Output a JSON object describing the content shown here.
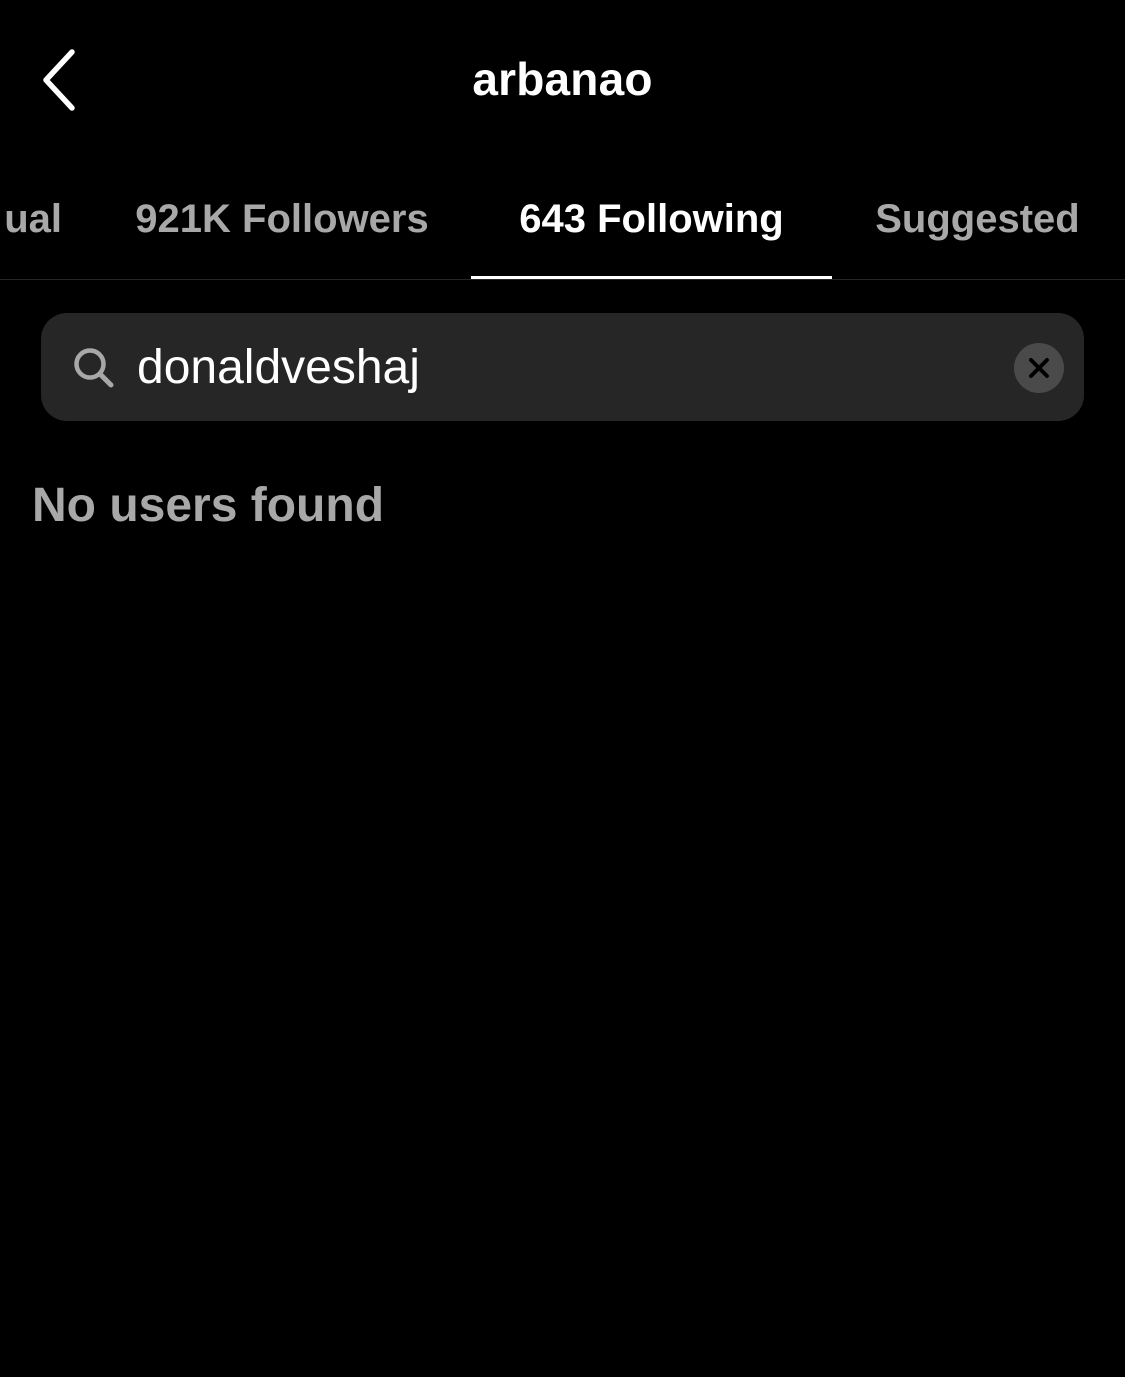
{
  "header": {
    "title": "arbanao",
    "back_icon": "chevron-left-icon"
  },
  "tabs": [
    {
      "label": "ual",
      "active": false
    },
    {
      "label": "921K Followers",
      "active": false
    },
    {
      "label": "643 Following",
      "active": true
    },
    {
      "label": "Suggested",
      "active": false
    }
  ],
  "search": {
    "value": "donaldveshaj",
    "icon": "search-icon",
    "clear_icon": "clear-icon"
  },
  "results": {
    "empty_message": "No users found"
  },
  "colors": {
    "background": "#000000",
    "primary_text": "#ffffff",
    "secondary_text": "#a8a8a8",
    "search_background": "#262626",
    "divider": "#262626"
  }
}
